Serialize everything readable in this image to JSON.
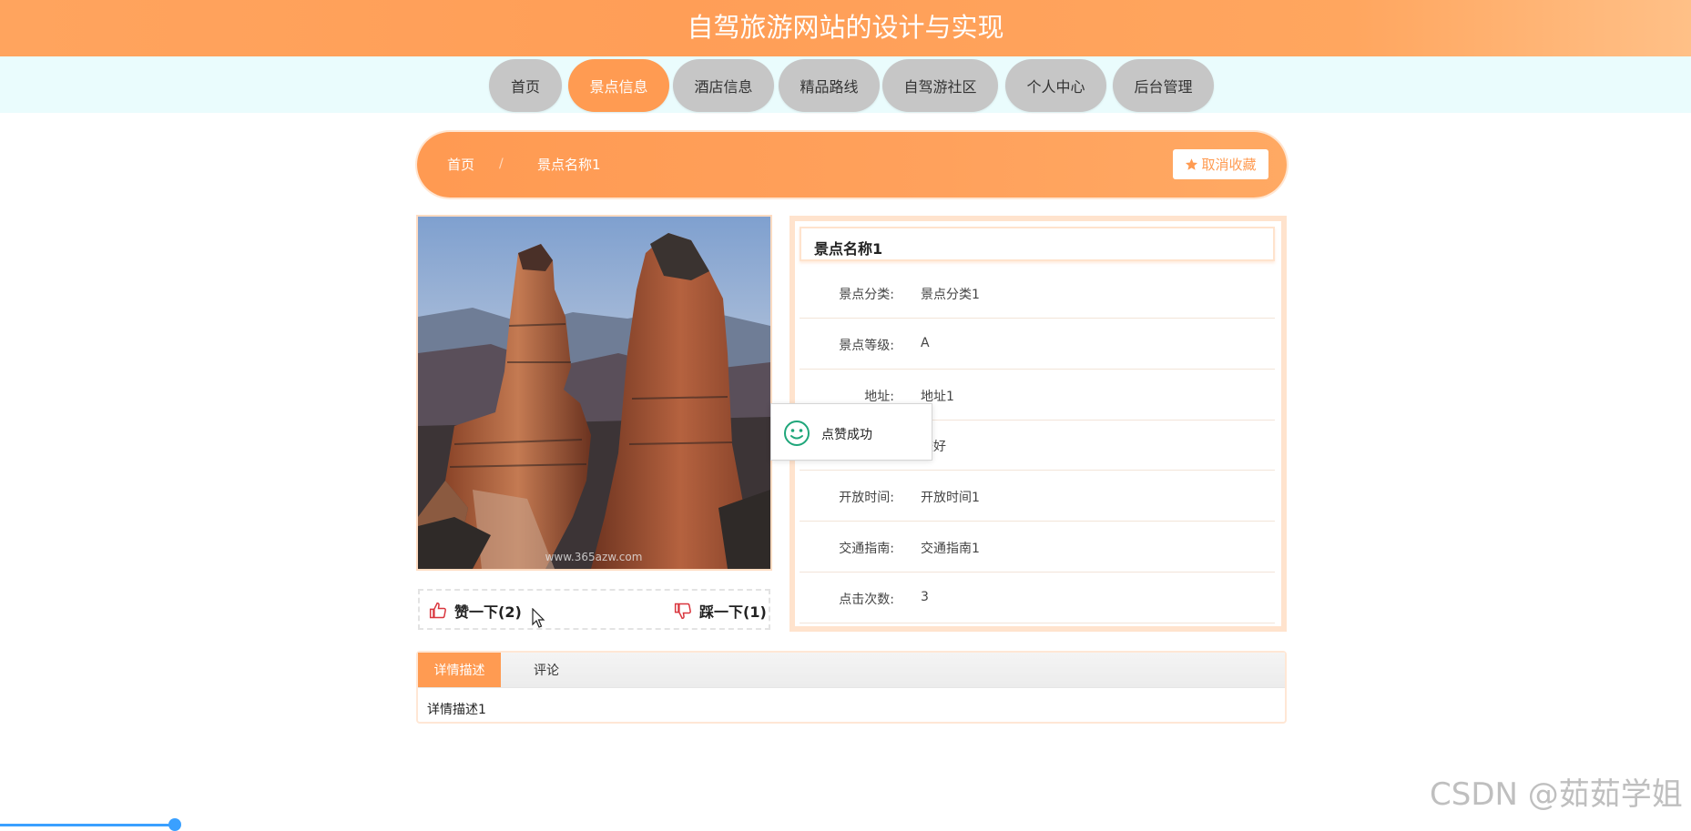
{
  "site": {
    "title": "自驾旅游网站的设计与实现"
  },
  "nav": {
    "items": [
      {
        "label": "首页"
      },
      {
        "label": "景点信息"
      },
      {
        "label": "酒店信息"
      },
      {
        "label": "精品路线"
      },
      {
        "label": "自驾游社区"
      },
      {
        "label": "个人中心"
      },
      {
        "label": "后台管理"
      }
    ],
    "active": "景点信息"
  },
  "breadcrumb": {
    "home": "首页",
    "separator": "/",
    "current": "景点名称1",
    "favorite_label": "取消收藏"
  },
  "photo": {
    "watermark_text": "www.365azw.com"
  },
  "votes": {
    "like_label": "赞一下(2)",
    "dislike_label": "踩一下(1)"
  },
  "detail": {
    "title": "景点名称1",
    "rows": [
      {
        "label": "景点分类:",
        "value": "景点分类1"
      },
      {
        "label": "景点等级:",
        "value": "A"
      },
      {
        "label": "地址:",
        "value": "地址1"
      },
      {
        "label": "",
        "value": "较好"
      },
      {
        "label": "开放时间:",
        "value": "开放时间1"
      },
      {
        "label": "交通指南:",
        "value": "交通指南1"
      },
      {
        "label": "点击次数:",
        "value": "3"
      }
    ]
  },
  "toast": {
    "message": "点赞成功"
  },
  "tabs": {
    "items": [
      {
        "label": "详情描述"
      },
      {
        "label": "评论"
      }
    ],
    "content": "详情描述1"
  },
  "watermark": {
    "text": "CSDN @茹茹学姐"
  },
  "colors": {
    "accent": "#ff9b52",
    "nav_inactive": "#c6c6c6",
    "nav_band": "#eafcfd",
    "like_icon": "#d9363e",
    "toast_icon": "#1fa67a"
  }
}
